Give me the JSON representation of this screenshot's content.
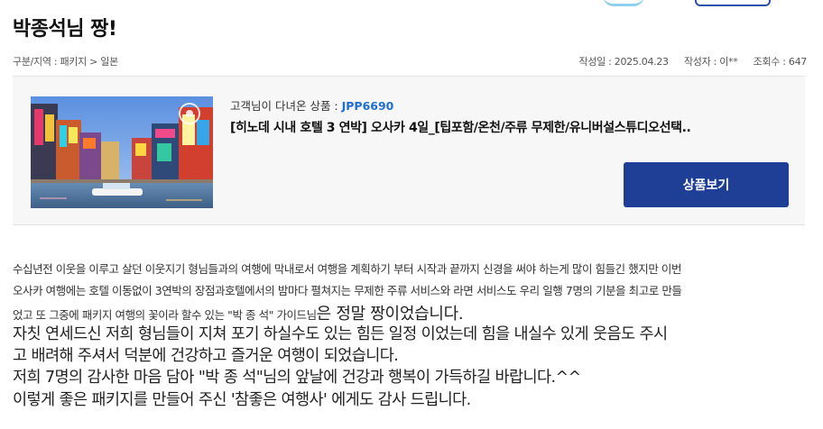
{
  "review": {
    "title": "박종석님 짱!",
    "category": "구분/지역 : 패키지 > 일본",
    "date": "작성일 : 2025.04.23",
    "author": "작성자 : 이**",
    "views": "조회수 : 647"
  },
  "product": {
    "label_prefix": "고객님이 다녀온 상품 : ",
    "code": "JPP6690",
    "title": "[히노데 시내 호텔 3 연박] 오사카 4일_[팁포함/온천/주류 무제한/유니버설스튜디오선택..",
    "view_button": "상품보기"
  },
  "content": {
    "line1": "수십년전 이웃을 이루고 살던 이웃지기 형님들과의 여행에 막내로서 여행을 계획하기 부터 시작과 끝까지 신경을 써야 하는게 많이 힘들긴 했지만 이번",
    "line2": "오사카 여행에는 호텔 이동없이 3연박의 장점과호텔에서의 밤마다 펼쳐지는 무제한 주류 서비스와 라면 서비스도 우리 일행 7명의 기분을 최고로 만들",
    "line3_small": "었고 또 그중에 패키지 여행의 꽃이라 할수 있는 \"박 종 석\" 가이드님",
    "line3_large": "은 정말 짱이었습니다.",
    "line4": "자칫 연세드신 저희 형님들이 지쳐 포기 하실수도 있는 힘든 일정 이었는데 힘을 내실수 있게 웃음도 주시",
    "line5": "고 배려해 주셔서 덕분에 건강하고 즐거운 여행이 되었습니다.",
    "line6": "저희 7명의 감사한 마음 담아 \"박 종 석\"님의 앞날에 건강과 행복이 가득하길 바랍니다.^^",
    "line7": "이렇게 좋은 패키지를 만들어 주신 '참좋은 여행사' 에게도 감사 드립니다."
  },
  "colors": {
    "button": "#1f3e96",
    "product_code": "#1f6fd1",
    "card_background": "#f7f7f7"
  }
}
